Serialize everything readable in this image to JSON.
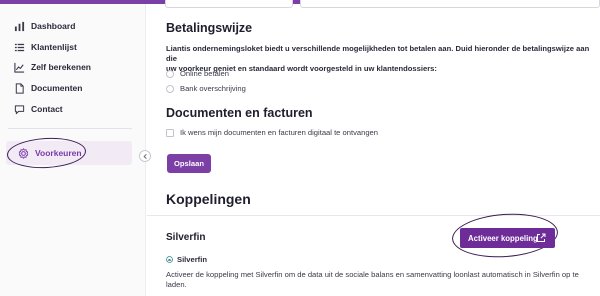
{
  "brand": {
    "accent": "#7b3fa5"
  },
  "sidebar": {
    "items": [
      {
        "label": "Dashboard",
        "icon": "bar-chart-icon"
      },
      {
        "label": "Klantenlijst",
        "icon": "list-icon"
      },
      {
        "label": "Zelf berekenen",
        "icon": "trend-line-icon"
      },
      {
        "label": "Documenten",
        "icon": "document-icon"
      },
      {
        "label": "Contact",
        "icon": "chat-bubble-icon"
      }
    ],
    "active": {
      "label": "Voorkeuren",
      "icon": "gear-icon"
    }
  },
  "betaling": {
    "title": "Betalingswijze",
    "description_line1": "Liantis ondernemingsloket biedt u verschillende mogelijkheden tot betalen aan. Duid hieronder de betalingswijze aan die",
    "description_line2": "uw voorkeur geniet en standaard wordt voorgesteld in uw klantendossiers:",
    "options": [
      "Online betalen",
      "Bank overschrijving"
    ]
  },
  "documenten": {
    "title": "Documenten en facturen",
    "checkbox_label": "Ik wens mijn documenten en facturen digitaal te ontvangen"
  },
  "save_button": "Opslaan",
  "koppelingen": {
    "title": "Koppelingen",
    "integration": {
      "title": "Silverfin",
      "button": "Activeer koppeling",
      "logo_label": "Silverfin",
      "description": "Activeer de koppeling met Silverfin om de data uit de sociale balans en samenvatting loonlast automatisch in Silverfin op te laden."
    }
  }
}
